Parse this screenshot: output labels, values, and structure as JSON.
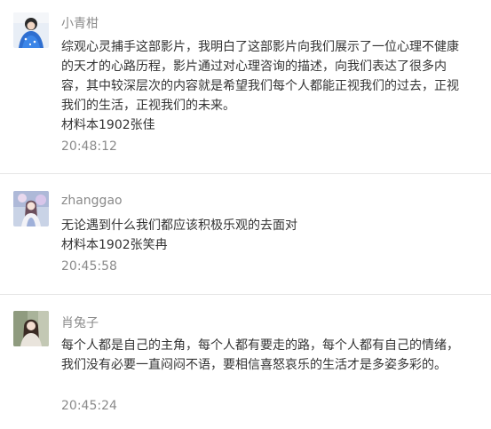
{
  "comments": [
    {
      "name": "小青柑",
      "content": [
        "综观心灵捕手这部影片，我明白了这部影片向我们展示了一位心理不健康的天才的心路历程，影片通过对心理咨询的描述，向我们表达了很多内容，其中较深层次的内容就是希望我们每个人都能正视我们的过去，正视我们的生活，正视我们的未来。",
        "材料本1902张佳"
      ],
      "time": "20:48:12"
    },
    {
      "name": "zhanggao",
      "content": [
        "无论遇到什么我们都应该积极乐观的去面对",
        "材料本1902张笑冉"
      ],
      "time": "20:45:58"
    },
    {
      "name": "肖兔子",
      "content": [
        "每个人都是自己的主角，每个人都有要走的路，每个人都有自己的情绪，我们没有必要一直闷闷不语，要相信喜怒哀乐的生活才是多姿多彩的。"
      ],
      "time": "20:45:24"
    }
  ]
}
